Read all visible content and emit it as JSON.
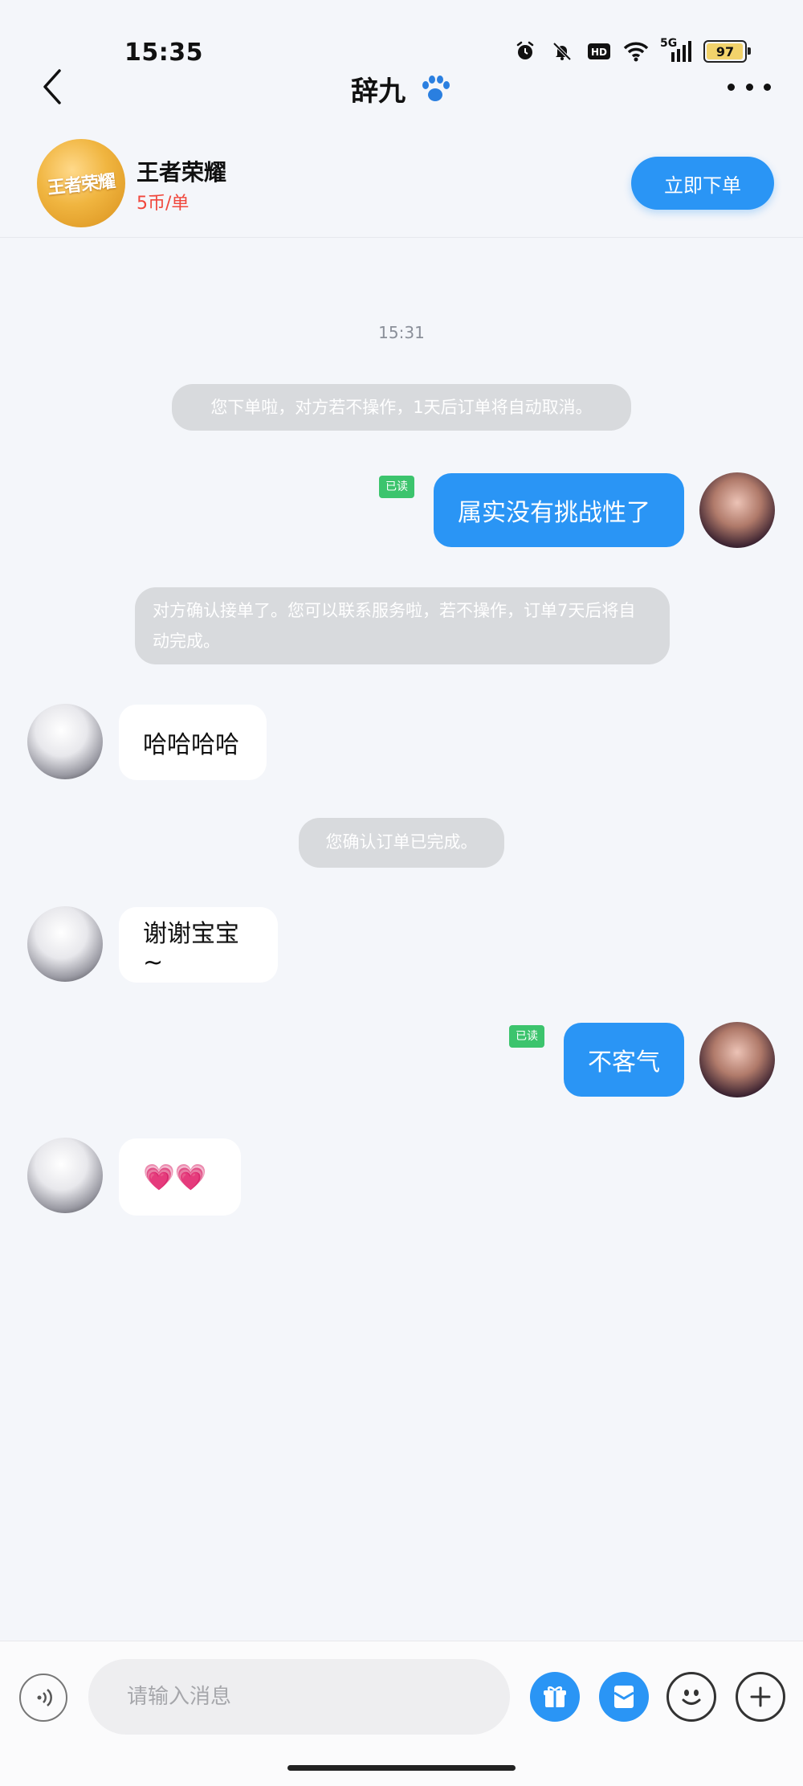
{
  "status_bar": {
    "time": "15:35",
    "network": "5G",
    "hd_label": "HD",
    "battery": "97",
    "icons": [
      "alarm-icon",
      "mute-icon",
      "hd-icon",
      "wifi-icon",
      "signal-icon",
      "battery-icon"
    ]
  },
  "header": {
    "title": "辞九",
    "back_icon": "chevron-left-icon",
    "title_icon": "paw-icon",
    "more_icon": "more-dots-icon"
  },
  "game_card": {
    "name": "王者荣耀",
    "price": "5币/单",
    "order_button": "立即下单",
    "logo_text": "王者荣耀"
  },
  "chat": {
    "timestamp": "15:31",
    "messages": [
      {
        "type": "system",
        "text": "您下单啦，对方若不操作，1天后订单将自动取消。"
      },
      {
        "type": "me",
        "text": "属实没有挑战性了",
        "read_label": "已读"
      },
      {
        "type": "system",
        "text": "对方确认接单了。您可以联系服务啦，若不操作，订单7天后将自动完成。"
      },
      {
        "type": "other",
        "text": "哈哈哈哈"
      },
      {
        "type": "system",
        "text": "您确认订单已完成。"
      },
      {
        "type": "other",
        "text": "谢谢宝宝~"
      },
      {
        "type": "me",
        "text": "不客气",
        "read_label": "已读"
      },
      {
        "type": "other",
        "text": "💗💗"
      }
    ]
  },
  "input_bar": {
    "placeholder": "请输入消息",
    "icons": [
      "voice-icon",
      "gift-icon",
      "red-packet-icon",
      "emoji-icon",
      "plus-icon"
    ]
  },
  "colors": {
    "accent": "#2a95f5",
    "price": "#f0473c",
    "read_tag": "#3cc46d",
    "system_bubble": "#d8dadd",
    "background": "#f4f6fa"
  }
}
